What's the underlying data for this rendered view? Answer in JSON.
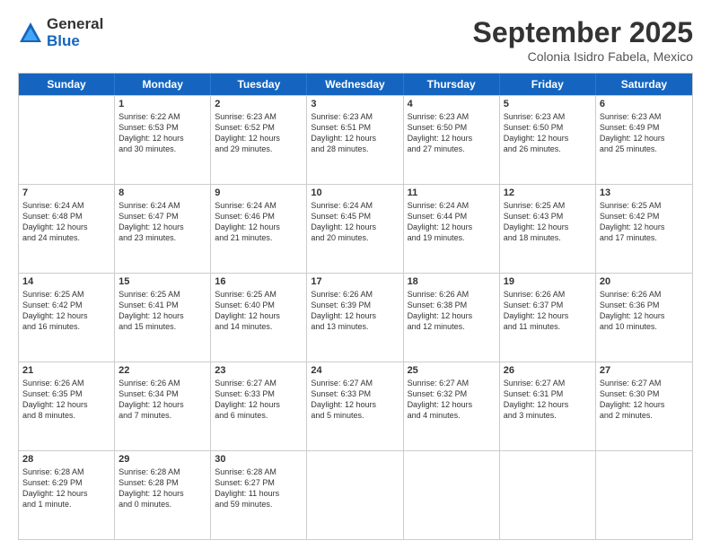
{
  "logo": {
    "general": "General",
    "blue": "Blue"
  },
  "title": "September 2025",
  "subtitle": "Colonia Isidro Fabela, Mexico",
  "header_days": [
    "Sunday",
    "Monday",
    "Tuesday",
    "Wednesday",
    "Thursday",
    "Friday",
    "Saturday"
  ],
  "rows": [
    [
      {
        "day": "",
        "text": ""
      },
      {
        "day": "1",
        "text": "Sunrise: 6:22 AM\nSunset: 6:53 PM\nDaylight: 12 hours\nand 30 minutes."
      },
      {
        "day": "2",
        "text": "Sunrise: 6:23 AM\nSunset: 6:52 PM\nDaylight: 12 hours\nand 29 minutes."
      },
      {
        "day": "3",
        "text": "Sunrise: 6:23 AM\nSunset: 6:51 PM\nDaylight: 12 hours\nand 28 minutes."
      },
      {
        "day": "4",
        "text": "Sunrise: 6:23 AM\nSunset: 6:50 PM\nDaylight: 12 hours\nand 27 minutes."
      },
      {
        "day": "5",
        "text": "Sunrise: 6:23 AM\nSunset: 6:50 PM\nDaylight: 12 hours\nand 26 minutes."
      },
      {
        "day": "6",
        "text": "Sunrise: 6:23 AM\nSunset: 6:49 PM\nDaylight: 12 hours\nand 25 minutes."
      }
    ],
    [
      {
        "day": "7",
        "text": "Sunrise: 6:24 AM\nSunset: 6:48 PM\nDaylight: 12 hours\nand 24 minutes."
      },
      {
        "day": "8",
        "text": "Sunrise: 6:24 AM\nSunset: 6:47 PM\nDaylight: 12 hours\nand 23 minutes."
      },
      {
        "day": "9",
        "text": "Sunrise: 6:24 AM\nSunset: 6:46 PM\nDaylight: 12 hours\nand 21 minutes."
      },
      {
        "day": "10",
        "text": "Sunrise: 6:24 AM\nSunset: 6:45 PM\nDaylight: 12 hours\nand 20 minutes."
      },
      {
        "day": "11",
        "text": "Sunrise: 6:24 AM\nSunset: 6:44 PM\nDaylight: 12 hours\nand 19 minutes."
      },
      {
        "day": "12",
        "text": "Sunrise: 6:25 AM\nSunset: 6:43 PM\nDaylight: 12 hours\nand 18 minutes."
      },
      {
        "day": "13",
        "text": "Sunrise: 6:25 AM\nSunset: 6:42 PM\nDaylight: 12 hours\nand 17 minutes."
      }
    ],
    [
      {
        "day": "14",
        "text": "Sunrise: 6:25 AM\nSunset: 6:42 PM\nDaylight: 12 hours\nand 16 minutes."
      },
      {
        "day": "15",
        "text": "Sunrise: 6:25 AM\nSunset: 6:41 PM\nDaylight: 12 hours\nand 15 minutes."
      },
      {
        "day": "16",
        "text": "Sunrise: 6:25 AM\nSunset: 6:40 PM\nDaylight: 12 hours\nand 14 minutes."
      },
      {
        "day": "17",
        "text": "Sunrise: 6:26 AM\nSunset: 6:39 PM\nDaylight: 12 hours\nand 13 minutes."
      },
      {
        "day": "18",
        "text": "Sunrise: 6:26 AM\nSunset: 6:38 PM\nDaylight: 12 hours\nand 12 minutes."
      },
      {
        "day": "19",
        "text": "Sunrise: 6:26 AM\nSunset: 6:37 PM\nDaylight: 12 hours\nand 11 minutes."
      },
      {
        "day": "20",
        "text": "Sunrise: 6:26 AM\nSunset: 6:36 PM\nDaylight: 12 hours\nand 10 minutes."
      }
    ],
    [
      {
        "day": "21",
        "text": "Sunrise: 6:26 AM\nSunset: 6:35 PM\nDaylight: 12 hours\nand 8 minutes."
      },
      {
        "day": "22",
        "text": "Sunrise: 6:26 AM\nSunset: 6:34 PM\nDaylight: 12 hours\nand 7 minutes."
      },
      {
        "day": "23",
        "text": "Sunrise: 6:27 AM\nSunset: 6:33 PM\nDaylight: 12 hours\nand 6 minutes."
      },
      {
        "day": "24",
        "text": "Sunrise: 6:27 AM\nSunset: 6:33 PM\nDaylight: 12 hours\nand 5 minutes."
      },
      {
        "day": "25",
        "text": "Sunrise: 6:27 AM\nSunset: 6:32 PM\nDaylight: 12 hours\nand 4 minutes."
      },
      {
        "day": "26",
        "text": "Sunrise: 6:27 AM\nSunset: 6:31 PM\nDaylight: 12 hours\nand 3 minutes."
      },
      {
        "day": "27",
        "text": "Sunrise: 6:27 AM\nSunset: 6:30 PM\nDaylight: 12 hours\nand 2 minutes."
      }
    ],
    [
      {
        "day": "28",
        "text": "Sunrise: 6:28 AM\nSunset: 6:29 PM\nDaylight: 12 hours\nand 1 minute."
      },
      {
        "day": "29",
        "text": "Sunrise: 6:28 AM\nSunset: 6:28 PM\nDaylight: 12 hours\nand 0 minutes."
      },
      {
        "day": "30",
        "text": "Sunrise: 6:28 AM\nSunset: 6:27 PM\nDaylight: 11 hours\nand 59 minutes."
      },
      {
        "day": "",
        "text": ""
      },
      {
        "day": "",
        "text": ""
      },
      {
        "day": "",
        "text": ""
      },
      {
        "day": "",
        "text": ""
      }
    ]
  ]
}
